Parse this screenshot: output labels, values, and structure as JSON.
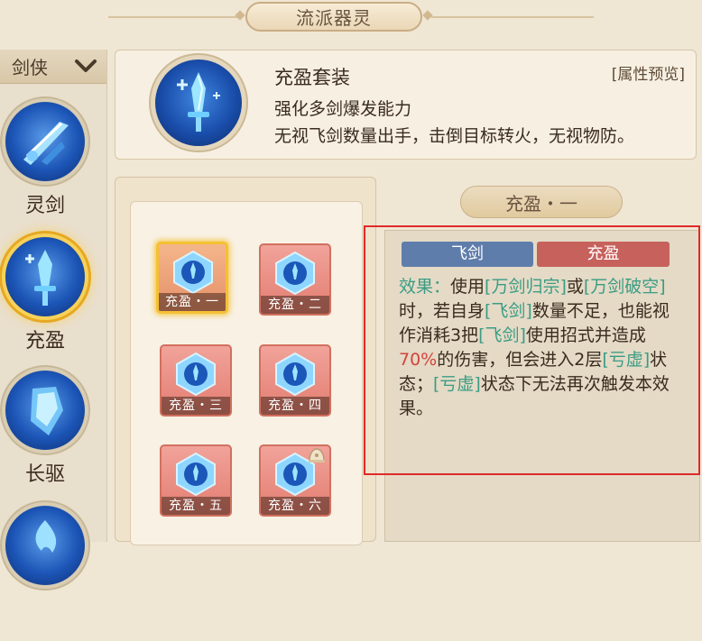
{
  "header": {
    "title": "流派器灵"
  },
  "sidebar": {
    "class_selector": "剑侠",
    "items": [
      {
        "label": "灵剑"
      },
      {
        "label": "充盈"
      },
      {
        "label": "长驱"
      }
    ]
  },
  "info": {
    "title": "充盈套装",
    "preview_link": "[属性预览]",
    "line1": "强化多剑爆发能力",
    "line2": "无视飞剑数量出手，击倒目标转火，无视物防。"
  },
  "skills": [
    {
      "label": "充盈・一"
    },
    {
      "label": "充盈・二"
    },
    {
      "label": "充盈・三"
    },
    {
      "label": "充盈・四"
    },
    {
      "label": "充盈・五"
    },
    {
      "label": "充盈・六"
    }
  ],
  "detail": {
    "tab_title": "充盈・一",
    "tag_blue": "飞剑",
    "tag_red": "充盈",
    "effect": {
      "prefix": "效果：",
      "t1": "使用",
      "g1": "[万剑归宗]",
      "t2": "或",
      "g2": "[万剑破空]",
      "t3": "时，若自身",
      "g3": "[飞剑]",
      "t4": "数量不足，也能视作消耗3把",
      "g4": "[飞剑]",
      "t5": "使用招式并造成",
      "r1": "70%",
      "t6": "的伤害，但会进入2层",
      "g5": "[亏虚]",
      "t7": "状态；",
      "g6": "[亏虚]",
      "t8": "状态下无法再次触发本效果。"
    }
  },
  "colors": {
    "highlight_red": "#e02a2a",
    "effect_green": "#3b9c84",
    "selected_gold": "#f5c033"
  }
}
